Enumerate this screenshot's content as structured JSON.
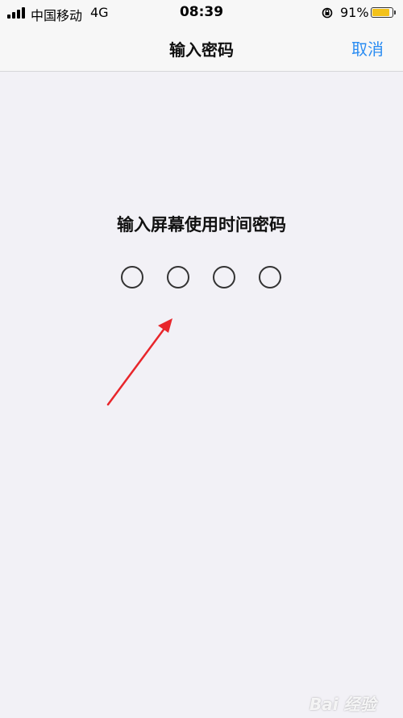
{
  "status_bar": {
    "carrier": "中国移动",
    "network": "4G",
    "time": "08:39",
    "battery_percent": "91%",
    "battery_level": 0.91,
    "battery_color": "#f3c21a",
    "icons": [
      "signal-icon",
      "rotation-lock-icon",
      "battery-icon"
    ]
  },
  "nav": {
    "title": "输入密码",
    "cancel_label": "取消",
    "accent_color": "#2a8cf2"
  },
  "content": {
    "prompt": "输入屏幕使用时间密码",
    "passcode_digits": 4,
    "entered_digits": 0
  },
  "annotation": {
    "arrow_color": "#e8262b",
    "icon": "arrow-icon"
  },
  "watermark": {
    "text": "Bai 经验"
  }
}
